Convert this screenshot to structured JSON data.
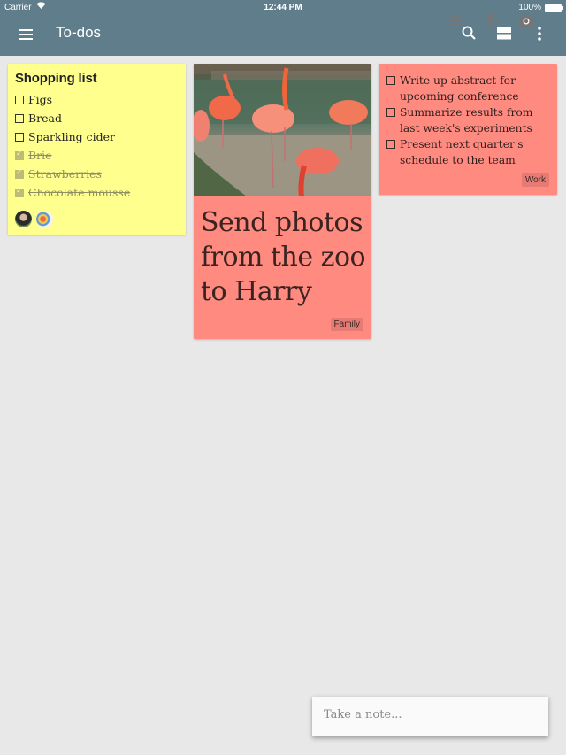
{
  "status_bar": {
    "carrier": "Carrier",
    "time": "12:44 PM",
    "battery": "100%"
  },
  "app_bar": {
    "title": "To-dos",
    "icons": [
      "menu-icon",
      "search-icon",
      "view-toggle-icon",
      "more-vert-icon"
    ]
  },
  "notes": [
    {
      "type": "checklist",
      "color": "#ffff8d",
      "title": "Shopping list",
      "items": [
        {
          "text": "Figs",
          "checked": false
        },
        {
          "text": "Bread",
          "checked": false
        },
        {
          "text": "Sparkling cider",
          "checked": false
        },
        {
          "text": "Brie",
          "checked": true
        },
        {
          "text": "Strawberries",
          "checked": true
        },
        {
          "text": "Chocolate mousse",
          "checked": true
        }
      ],
      "collaborators": [
        "collaborator-1",
        "collaborator-2"
      ]
    },
    {
      "type": "photo",
      "color": "#ff8a80",
      "image": "flamingos",
      "text": "Send photos from the zoo to Harry",
      "label": "Family"
    },
    {
      "type": "checklist",
      "color": "#ff8a80",
      "items": [
        {
          "text": "Write up abstract for upcoming conference",
          "checked": false
        },
        {
          "text": "Summarize results from last week's experiments",
          "checked": false
        },
        {
          "text": "Present next quarter's schedule to the team",
          "checked": false
        }
      ],
      "label": "Work"
    }
  ],
  "take_note": {
    "placeholder": "Take a note...",
    "icons": [
      "list-icon",
      "mic-icon",
      "camera-icon"
    ]
  }
}
